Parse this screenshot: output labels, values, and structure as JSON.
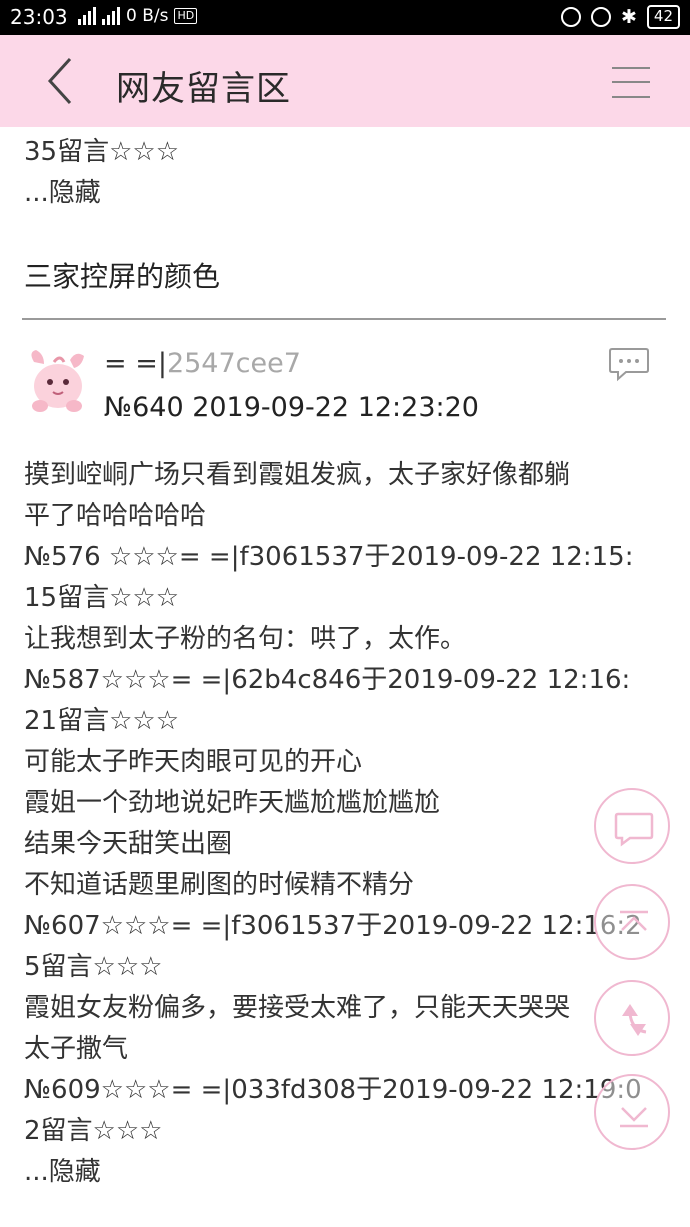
{
  "status_bar": {
    "time": "23:03",
    "net_speed": "0 B/s",
    "network_label": "4G",
    "hd_label": "HD",
    "battery": "42"
  },
  "header": {
    "title": "网友留言区",
    "back_icon": "chevron-left-icon",
    "menu_icon": "hamburger-menu-icon",
    "background": "#fcd8e8"
  },
  "prev_snippet": {
    "lines": [
      "35留言☆☆☆",
      "...隐藏"
    ]
  },
  "section_title": "三家控屏的颜色",
  "post": {
    "user_prefix": "= =|",
    "user_id": "2547cee7",
    "meta": "№640  2019-09-22 12:23:20",
    "reply_icon": "comment-icon",
    "lines": [
      "摸到崆峒广场只看到霞姐发疯，太子家好像都躺",
      "平了哈哈哈哈哈",
      "№576 ☆☆☆= =|f3061537于2019-09-22 12:15:",
      "15留言☆☆☆",
      "让我想到太子粉的名句：哄了，太作。",
      "№587☆☆☆= =|62b4c846于2019-09-22 12:16:",
      "21留言☆☆☆",
      "可能太子昨天肉眼可见的开心",
      "霞姐一个劲地说妃昨天尴尬尴尬尴尬",
      "结果今天甜笑出圈",
      "不知道话题里刷图的时候精不精分",
      "№607☆☆☆= =|f3061537于2019-09-22 12:16:2",
      "5留言☆☆☆",
      "霞姐女友粉偏多，要接受太难了，只能天天哭哭",
      "太子撒气",
      "№609☆☆☆= =|033fd308于2019-09-22 12:19:0",
      "2留言☆☆☆",
      "...隐藏"
    ]
  },
  "floating_buttons": [
    {
      "icon": "comment-icon"
    },
    {
      "icon": "scroll-top-icon"
    },
    {
      "icon": "refresh-icon"
    },
    {
      "icon": "scroll-bottom-icon"
    }
  ],
  "colors": {
    "accent_pink": "#fcd8e8",
    "fab_border": "#f0b8d0",
    "user_id_gray": "#a8a8a8"
  }
}
